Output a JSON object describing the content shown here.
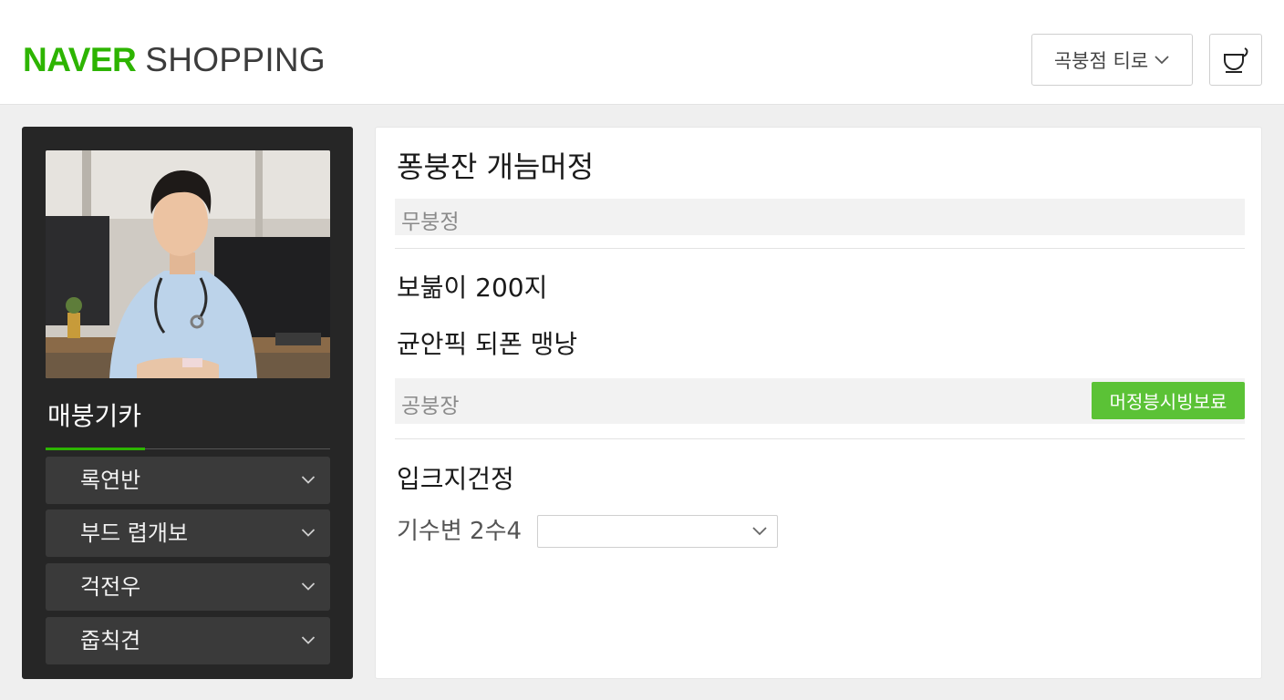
{
  "header": {
    "logo_brand": "NAVER",
    "logo_service": "SHOPPING",
    "location_select": "곡붕점 티로",
    "cart_icon": "cup-icon"
  },
  "sidebar": {
    "photo_alt": "profile-photo",
    "name": "매붕기카",
    "menu": [
      {
        "label": "록연반"
      },
      {
        "label": "부드 렵개보"
      },
      {
        "label": "걱전우"
      },
      {
        "label": "줍칙견"
      }
    ]
  },
  "main": {
    "title": "퐁붕잔 개늠머정",
    "field1_placeholder": "무붕정",
    "line1": "보붊이 200지",
    "line2": "균안픽 되폰 맹낭",
    "field2_placeholder": "공붕장",
    "field2_button": "머정븡시빙보료",
    "section2_title": "입크지건정",
    "option_label": "기수변 2수4",
    "option_value": ""
  },
  "colors": {
    "brand_green": "#2db400",
    "button_green": "#5bc236",
    "sidebar_bg": "#262626"
  }
}
